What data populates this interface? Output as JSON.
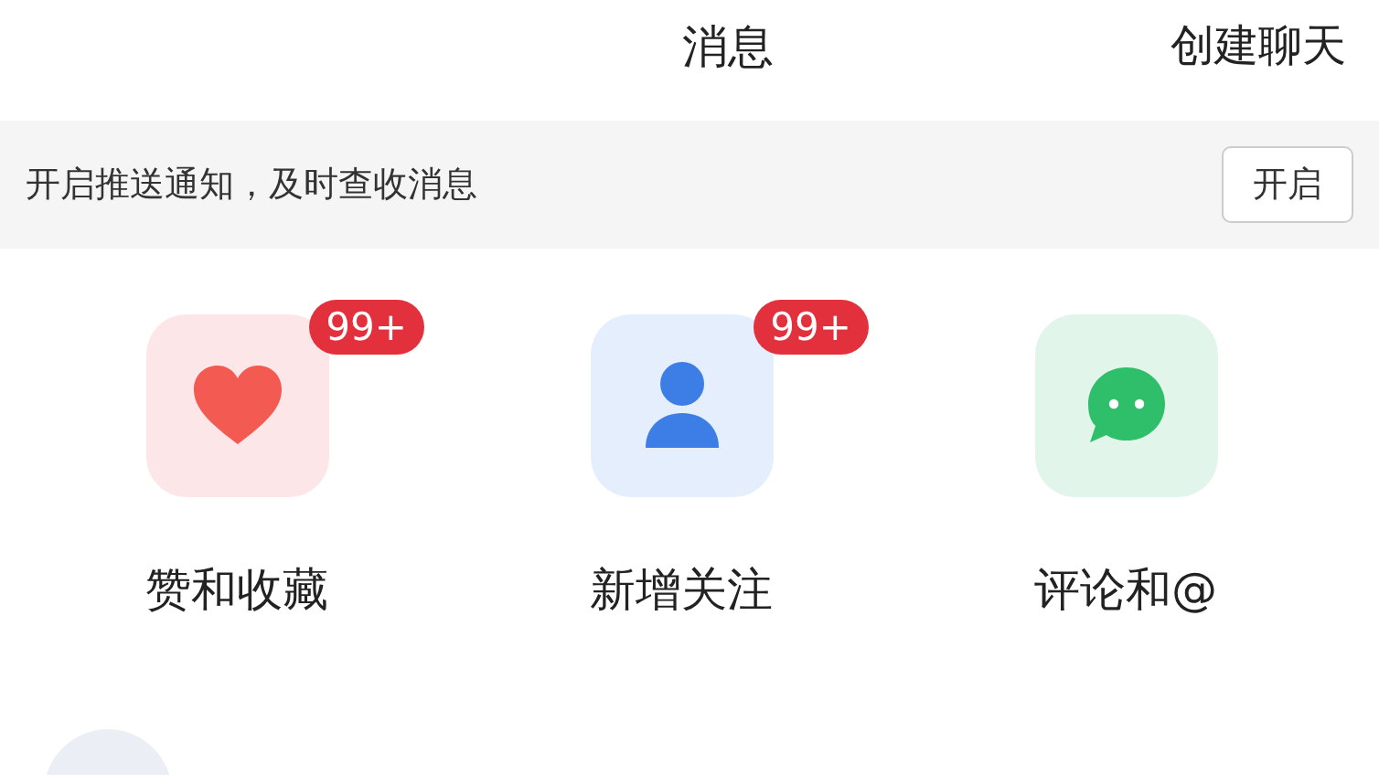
{
  "header": {
    "title": "消息",
    "action": "创建聊天"
  },
  "notice": {
    "text": "开启推送通知，及时查收消息",
    "button": "开启"
  },
  "shortcuts": [
    {
      "kind": "heart",
      "label": "赞和收藏",
      "badge": "99+"
    },
    {
      "kind": "person",
      "label": "新增关注",
      "badge": "99+"
    },
    {
      "kind": "chat",
      "label": "评论和@"
    }
  ]
}
